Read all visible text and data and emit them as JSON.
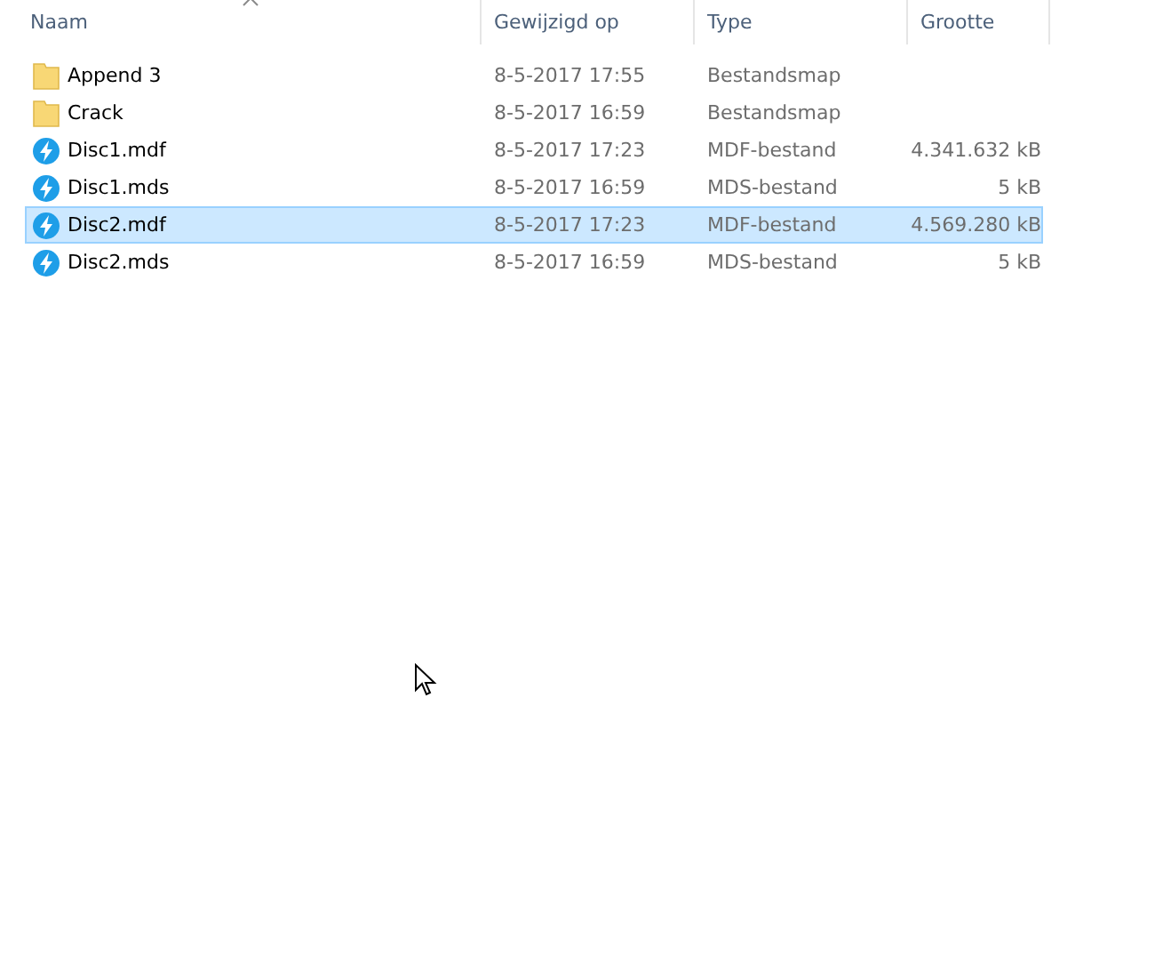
{
  "columns": [
    {
      "label": "Naam",
      "sorted": true
    },
    {
      "label": "Gewijzigd op",
      "sorted": false
    },
    {
      "label": "Type",
      "sorted": false
    },
    {
      "label": "Grootte",
      "sorted": false
    }
  ],
  "rows": [
    {
      "kind": "folder",
      "name": "Append 3",
      "modified": "8-5-2017 17:55",
      "type": "Bestandsmap",
      "selected": false
    },
    {
      "kind": "folder",
      "name": "Crack",
      "modified": "8-5-2017 16:59",
      "type": "Bestandsmap",
      "selected": false
    },
    {
      "kind": "disc",
      "name": "Disc1.mdf",
      "modified": "8-5-2017 17:23",
      "type": "MDF-bestand",
      "size": "4.341.632 kB",
      "selected": false
    },
    {
      "kind": "disc",
      "name": "Disc1.mds",
      "modified": "8-5-2017 16:59",
      "type": "MDS-bestand",
      "size": "5 kB",
      "selected": false
    },
    {
      "kind": "disc",
      "name": "Disc2.mdf",
      "modified": "8-5-2017 17:23",
      "type": "MDF-bestand",
      "size": "4.569.280 kB",
      "selected": true
    },
    {
      "kind": "disc",
      "name": "Disc2.mds",
      "modified": "8-5-2017 16:59",
      "type": "MDS-bestand",
      "size": "5 kB",
      "selected": false
    }
  ]
}
